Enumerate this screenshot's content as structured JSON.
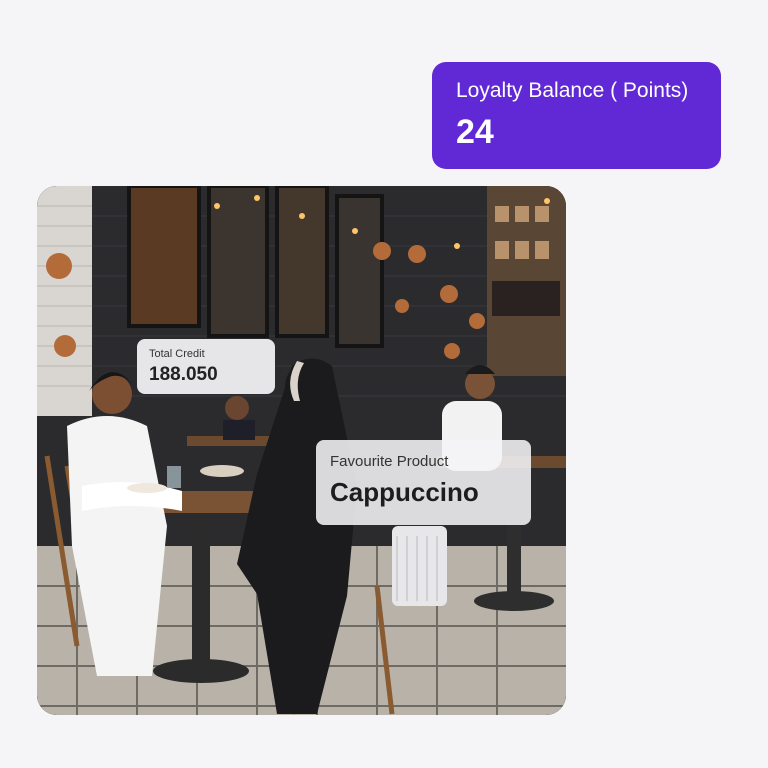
{
  "loyalty": {
    "title": "Loyalty Balance ( Points)",
    "value": "24",
    "accent": "#6128d6"
  },
  "credit": {
    "label": "Total Credit",
    "value": "188.050"
  },
  "favourite": {
    "label": "Favourite Product",
    "value": "Cappuccino"
  },
  "photo": {
    "subject": "restaurant-dining-scene"
  }
}
